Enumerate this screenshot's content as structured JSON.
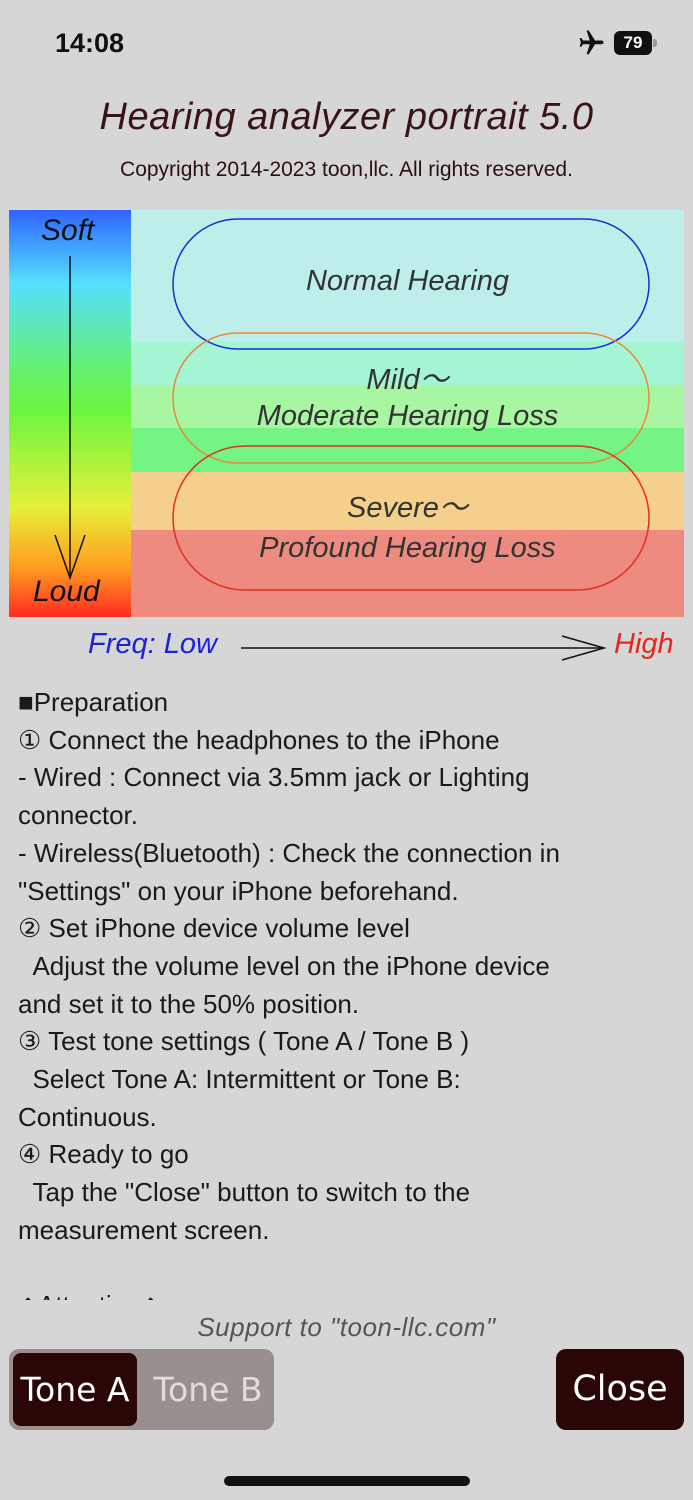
{
  "status_bar": {
    "time": "14:08",
    "battery_level": "79",
    "airplane_icon": "airplane-icon"
  },
  "header": {
    "title": "Hearing analyzer portrait 5.0",
    "copyright": "Copyright 2014-2023 toon,llc. All rights reserved."
  },
  "chart": {
    "loudness_top": "Soft",
    "loudness_bottom": "Loud",
    "zones": {
      "normal": "Normal Hearing",
      "mild_line1": "Mild～",
      "mild_line2": "Moderate Hearing Loss",
      "severe_line1": "Severe～",
      "severe_line2": "Profound Hearing Loss"
    },
    "freq_low": "Freq: Low",
    "freq_high": "High",
    "colors": {
      "normal_band": "#bdeeea",
      "mild_band_a": "#a4f5d4",
      "mild_band_b": "#a8f5a2",
      "mild_band_c": "#74f484",
      "severe_band": "#f5d08c",
      "profound_band": "#ee8b80",
      "normal_outline": "#1b2fd0",
      "mild_outline": "#e88a3a",
      "severe_outline": "#e0301e"
    }
  },
  "instructions": {
    "lines": [
      "■Preparation",
      "① Connect the headphones to the iPhone",
      "- Wired : Connect via 3.5mm jack or Lighting",
      "connector.",
      "- Wireless(Bluetooth) : Check the connection in",
      "\"Settings\" on your iPhone beforehand.",
      "② Set iPhone device volume level",
      "  Adjust the volume level on the iPhone device",
      "and set it to the 50% position.",
      "③ Test tone settings ( Tone A / Tone B )",
      "  Select Tone A: Intermittent or Tone B:",
      "Continuous.",
      "④ Ready to go",
      "  Tap the \"Close\" button to switch to the",
      "measurement screen.",
      " ",
      "◆Attention◆"
    ]
  },
  "footer": {
    "support": "Support to \"toon-llc.com\"",
    "tone_a": "Tone A",
    "tone_b": "Tone B",
    "close": "Close",
    "selected_tone": "Tone A"
  }
}
